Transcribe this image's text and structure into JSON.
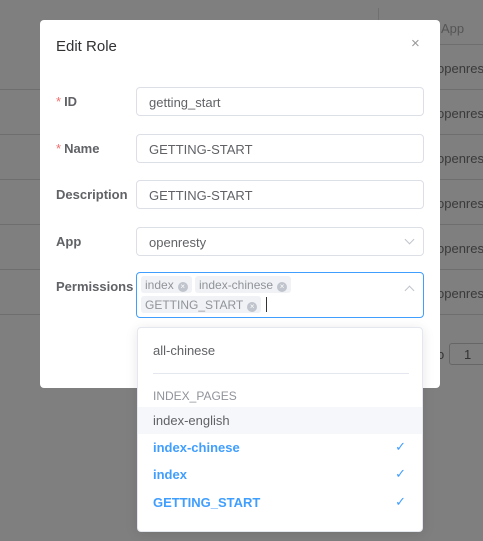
{
  "background": {
    "column_header": "App",
    "rows": [
      "openresty",
      "openresty",
      "openresty",
      "openresty",
      "openresty",
      "openresty"
    ],
    "pagination_label": "o",
    "page": "1"
  },
  "modal": {
    "title": "Edit Role",
    "close_icon": "×",
    "fields": {
      "id": {
        "label": "ID",
        "required": true,
        "value": "getting_start"
      },
      "name": {
        "label": "Name",
        "required": true,
        "value": "GETTING-START"
      },
      "description": {
        "label": "Description",
        "value": "GETTING-START"
      },
      "app": {
        "label": "App",
        "value": "openresty"
      },
      "permissions": {
        "label": "Permissions",
        "tags": [
          "index",
          "index-chinese",
          "GETTING_START"
        ]
      }
    }
  },
  "dropdown": {
    "options_top": [
      "all-chinese"
    ],
    "group": "INDEX_PAGES",
    "options": [
      {
        "label": "index-english",
        "selected": false
      },
      {
        "label": "index-chinese",
        "selected": true
      },
      {
        "label": "index",
        "selected": true
      },
      {
        "label": "GETTING_START",
        "selected": true
      }
    ],
    "check": "✓"
  },
  "colors": {
    "accent": "#409eff",
    "required": "#f56c6c"
  }
}
